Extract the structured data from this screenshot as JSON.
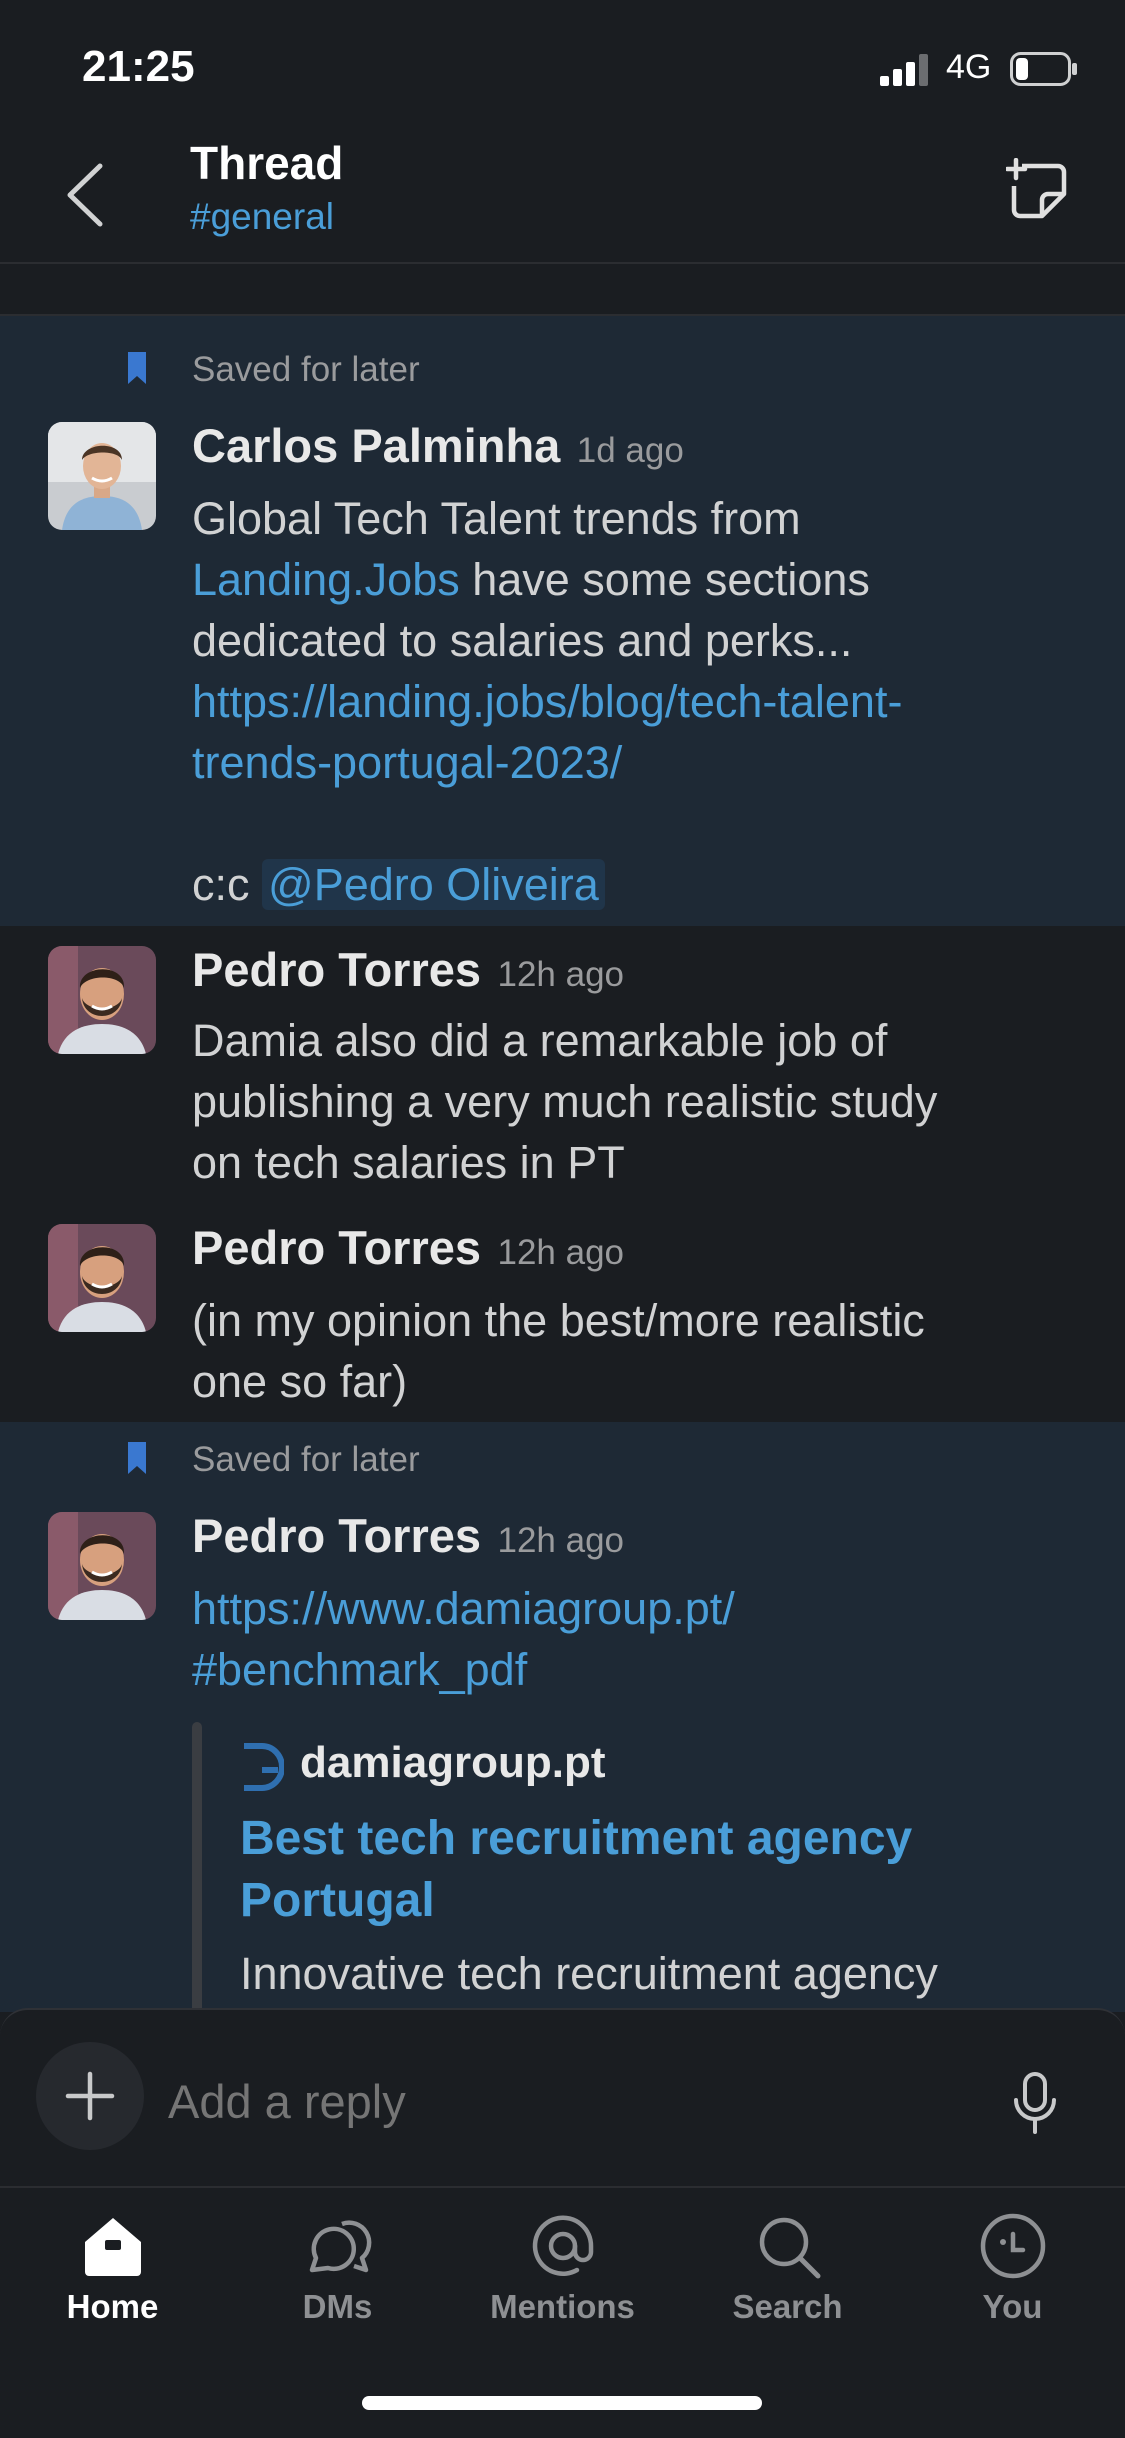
{
  "status_bar": {
    "time": "21:25",
    "network": "4G"
  },
  "header": {
    "title": "Thread",
    "channel": "#general"
  },
  "messages": [
    {
      "saved_label": "Saved for later",
      "author": "Carlos Palminha",
      "timestamp": "1d ago",
      "line1": "Global Tech Talent trends from",
      "line2_link": "Landing.Jobs",
      "line2_rest": " have some sections",
      "line3": "dedicated to salaries and perks...",
      "url_line1": "https://landing.jobs/blog/tech-talent-",
      "url_line2": "trends-portugal-2023/",
      "cc_prefix": "c:c ",
      "mention": "@Pedro Oliveira"
    },
    {
      "author": "Pedro Torres",
      "timestamp": "12h ago",
      "line1": "Damia also did a remarkable job of",
      "line2": "publishing a very much realistic study",
      "line3": "on tech salaries in PT"
    },
    {
      "author": "Pedro Torres",
      "timestamp": "12h ago",
      "line1": "(in my opinion the best/more realistic",
      "line2": "one so far)"
    },
    {
      "saved_label": "Saved for later",
      "author": "Pedro Torres",
      "timestamp": "12h ago",
      "url_line1": "https://www.damiagroup.pt/",
      "url_line2": "#benchmark_pdf",
      "unfurl": {
        "site": "damiagroup.pt",
        "title": "Best tech recruitment agency Portugal",
        "description": "Innovative tech recruitment agency"
      }
    }
  ],
  "composer": {
    "placeholder": "Add a reply"
  },
  "tabs": [
    {
      "label": "Home",
      "icon": "home-icon",
      "active": true
    },
    {
      "label": "DMs",
      "icon": "dms-icon"
    },
    {
      "label": "Mentions",
      "icon": "mentions-icon"
    },
    {
      "label": "Search",
      "icon": "search-icon"
    },
    {
      "label": "You",
      "icon": "you-icon"
    }
  ],
  "colors": {
    "background": "#1a1d21",
    "saved_background": "#1e2935",
    "link": "#4a9ed8",
    "bookmark": "#3a78d0"
  }
}
